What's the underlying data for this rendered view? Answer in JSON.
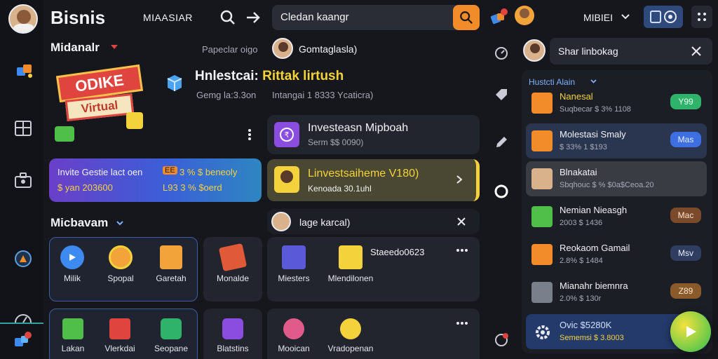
{
  "header": {
    "brand": "Bisnis",
    "nav_label": "MIAASIAR",
    "search_value": "Cledan kaangr",
    "user_label": "MIBIEI"
  },
  "left_panel": {
    "title": "Midanalr",
    "subtitle_right": "Papeclar oigo",
    "hero_badge_line1": "ODIKE",
    "hero_badge_line2": "Virtual",
    "hero_title_a": "Hnlestcai:",
    "hero_title_b": "Rittak lirtush",
    "hero_sub": "Gemg la:3.3on",
    "promo_left_line1": "Invite Gestie lact oen",
    "promo_left_line2": "$ yan 203600",
    "promo_right_line1": "3 % $ beneoly",
    "promo_right_line2": "L93 3 % $oerd",
    "promo_right_tag": "EE"
  },
  "middle_top": {
    "user_name": "Gomtaglasla)",
    "sub": "Intangai 1 8333 Ycaticra)",
    "invest_title": "Investeasn Mipboah",
    "invest_sub": "Serm $$ 0090)",
    "highlight_title": "Linvestsaiheme V180)",
    "highlight_sub": "Kenoada 30.1uhl"
  },
  "section2": {
    "title": "Micbavam",
    "right_title": "lage karcal)",
    "tiles_row1": [
      "Milik",
      "Spopal",
      "Garetah",
      "Monalde",
      "Miesters",
      "Mlendilonen"
    ],
    "tiles_row2": [
      "Lakan",
      "Vlerkdai",
      "Seopane",
      "Blatstins",
      "Mooican",
      "Vradopenan"
    ],
    "stat_label": "Staeedo0623"
  },
  "right_panel": {
    "search_text": "Shar linbokag",
    "header": "Hustcti Alain",
    "items": [
      {
        "title": "Nanesal",
        "sub": "Suqbecar $ 3% 1108",
        "pill": "Y99"
      },
      {
        "title": "Molestasi Smaly",
        "sub": "$ 33% 1 $193",
        "pill": "Mas"
      },
      {
        "title": "Blnakatai",
        "sub": "Sbqhouc $ % $0a$Ceoa.20",
        "pill": ""
      },
      {
        "title": "Nemian Nieasgh",
        "sub": "2003 $ 1436",
        "pill": "Mac"
      },
      {
        "title": "Reokaom Gamail",
        "sub": "2.8% $ 1484",
        "pill": "Msv"
      },
      {
        "title": "Mianahr biemnra",
        "sub": "2.0% $ 130r",
        "pill": "Z89"
      },
      {
        "title": "Ovic $5280K",
        "sub": "Sememsi $ 3.8003",
        "pill": ""
      }
    ]
  },
  "colors": {
    "accent_orange": "#f28b2a",
    "accent_blue": "#3d6fe0",
    "accent_green": "#2fb36a",
    "accent_yellow": "#f4d23c",
    "accent_purple": "#8b4ce0"
  }
}
